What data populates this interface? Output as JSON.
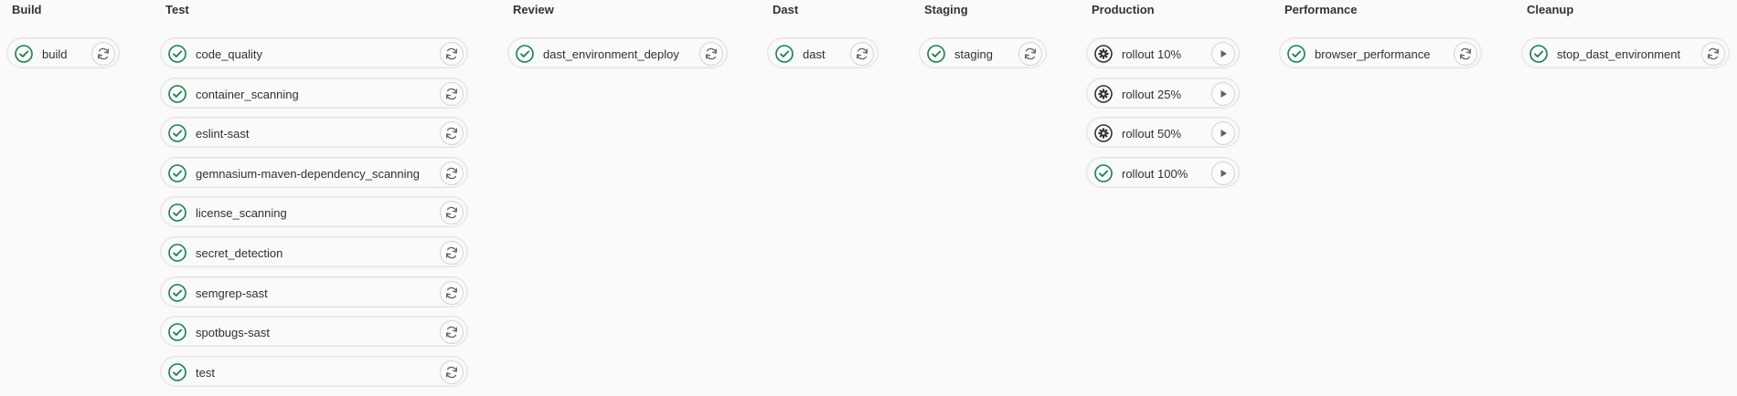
{
  "stages": [
    {
      "title": "Build",
      "jobs": [
        {
          "name": "build",
          "status": "success-icon",
          "action": "retry-icon"
        }
      ]
    },
    {
      "title": "Test",
      "jobs": [
        {
          "name": "code_quality",
          "status": "success-icon",
          "action": "retry-icon"
        },
        {
          "name": "container_scanning",
          "status": "success-icon",
          "action": "retry-icon"
        },
        {
          "name": "eslint-sast",
          "status": "success-icon",
          "action": "retry-icon"
        },
        {
          "name": "gemnasium-maven-dependency_scanning",
          "status": "success-icon",
          "action": "retry-icon"
        },
        {
          "name": "license_scanning",
          "status": "success-icon",
          "action": "retry-icon"
        },
        {
          "name": "secret_detection",
          "status": "success-icon",
          "action": "retry-icon"
        },
        {
          "name": "semgrep-sast",
          "status": "success-icon",
          "action": "retry-icon"
        },
        {
          "name": "spotbugs-sast",
          "status": "success-icon",
          "action": "retry-icon"
        },
        {
          "name": "test",
          "status": "success-icon",
          "action": "retry-icon"
        }
      ]
    },
    {
      "title": "Review",
      "jobs": [
        {
          "name": "dast_environment_deploy",
          "status": "success-icon",
          "action": "retry-icon"
        }
      ]
    },
    {
      "title": "Dast",
      "jobs": [
        {
          "name": "dast",
          "status": "success-icon",
          "action": "retry-icon"
        }
      ]
    },
    {
      "title": "Staging",
      "jobs": [
        {
          "name": "staging",
          "status": "success-icon",
          "action": "retry-icon"
        }
      ]
    },
    {
      "title": "Production",
      "jobs": [
        {
          "name": "rollout 10%",
          "status": "manual-gear-icon",
          "action": "play-icon"
        },
        {
          "name": "rollout 25%",
          "status": "manual-gear-icon",
          "action": "play-icon"
        },
        {
          "name": "rollout 50%",
          "status": "manual-gear-icon",
          "action": "play-icon"
        },
        {
          "name": "rollout 100%",
          "status": "success-icon",
          "action": "play-icon"
        }
      ]
    },
    {
      "title": "Performance",
      "jobs": [
        {
          "name": "browser_performance",
          "status": "success-icon",
          "action": "retry-icon"
        }
      ]
    },
    {
      "title": "Cleanup",
      "jobs": [
        {
          "name": "stop_dast_environment",
          "status": "success-icon",
          "action": "retry-icon"
        }
      ]
    }
  ],
  "colors": {
    "success": "#108548",
    "manual": "#333238",
    "icon_gray": "#626168"
  }
}
